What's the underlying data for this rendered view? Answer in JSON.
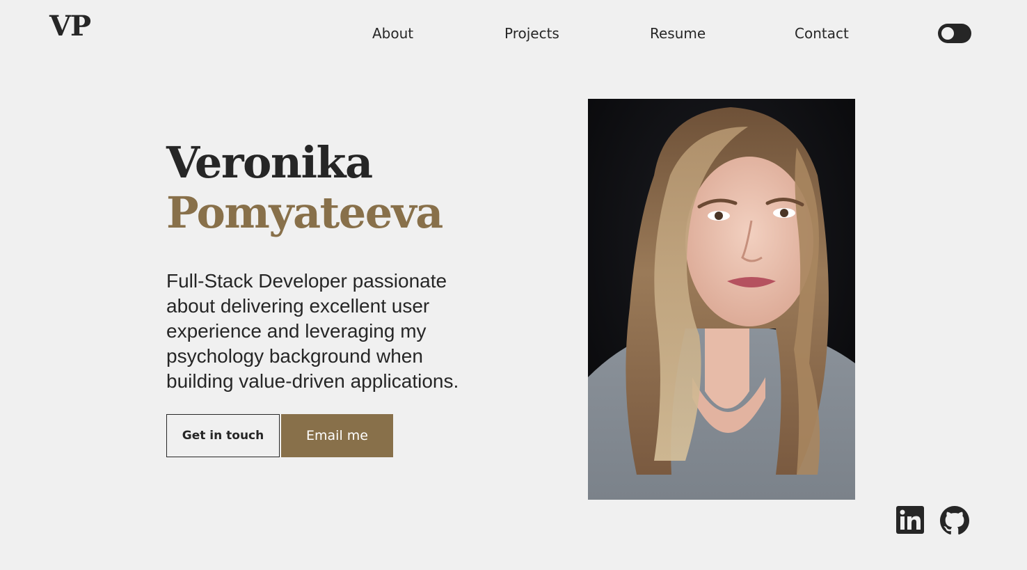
{
  "logo": "VP",
  "nav": {
    "about": "About",
    "projects": "Projects",
    "resume": "Resume",
    "contact": "Contact"
  },
  "theme_toggle": {
    "state": "dark-mode-off"
  },
  "hero": {
    "first_name": "Veronika",
    "last_name": "Pomyateeva",
    "tagline": "Full-Stack Developer passionate about delivering excellent user experience and leveraging my psychology background when building value-driven applications.",
    "buttons": {
      "get_in_touch": "Get in touch",
      "email_me": "Email me"
    }
  },
  "social": {
    "icons": [
      "linkedin-icon",
      "github-icon"
    ]
  },
  "colors": {
    "background": "#f0f0f0",
    "text": "#262626",
    "accent": "#88704a"
  }
}
